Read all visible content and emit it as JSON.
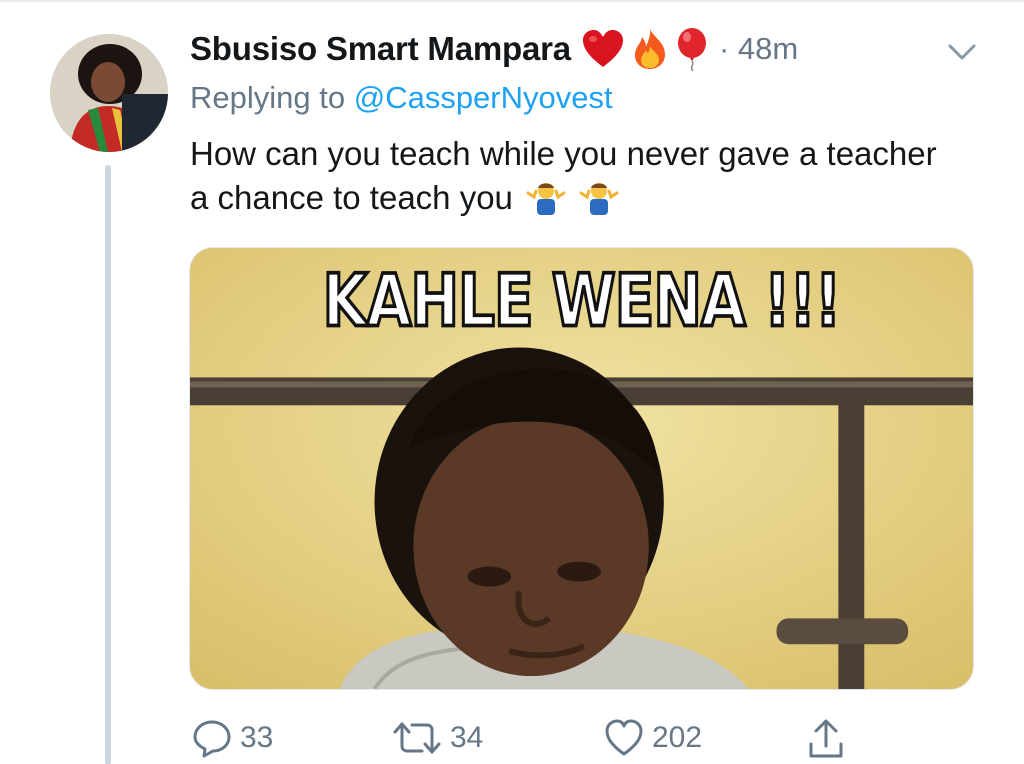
{
  "tweet": {
    "author": {
      "display_name": "Sbusiso Smart Mampara",
      "name_emojis": [
        "heart-emoji",
        "fire-emoji",
        "balloon-emoji"
      ]
    },
    "timestamp": "· 48m",
    "reply_prefix": "Replying to",
    "reply_handle": "@CassperNyovest",
    "text": "How can you teach while you never gave a teacher a chance to teach you",
    "text_emojis": [
      "person-shrugging-emoji",
      "person-shrugging-emoji"
    ],
    "media": {
      "caption": "KAHLE WENA !!!"
    },
    "actions": {
      "replies": "33",
      "retweets": "34",
      "likes": "202"
    }
  },
  "colors": {
    "text_primary": "#14171a",
    "text_secondary": "#657786",
    "link": "#1da1f2",
    "thread_line": "#cbd5de"
  },
  "icons": [
    "chevron-down-icon",
    "reply-icon",
    "retweet-icon",
    "like-icon",
    "share-icon"
  ]
}
